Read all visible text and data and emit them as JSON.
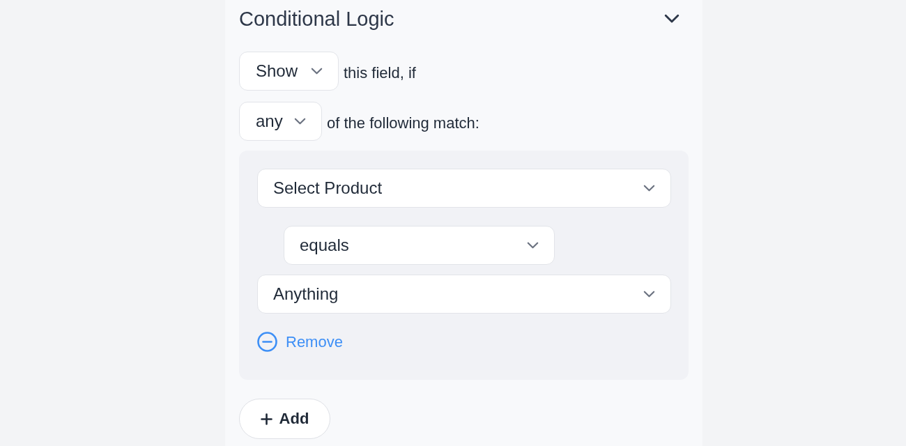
{
  "section": {
    "title": "Conditional Logic",
    "expanded": true
  },
  "action": {
    "value": "Show",
    "suffix": "this field, if"
  },
  "match": {
    "value": "any",
    "suffix": "of the following match:"
  },
  "conditions": [
    {
      "field": "Select Product",
      "operator": "equals",
      "value": "Anything",
      "remove_label": "Remove"
    }
  ],
  "add_button": {
    "label": "Add"
  }
}
